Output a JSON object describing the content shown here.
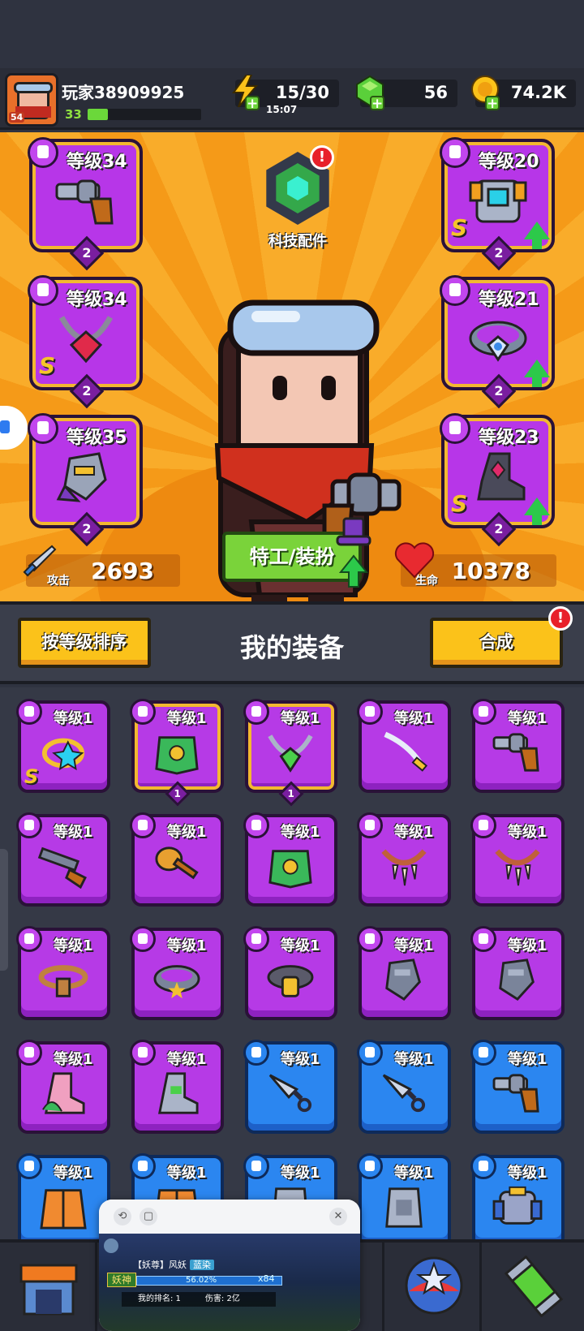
{
  "player": {
    "name": "玩家38909925",
    "level": "33",
    "avatar_level": "54",
    "xp_fraction": 0.18
  },
  "resources": {
    "energy": {
      "value": "15/30",
      "timer": "15:07",
      "icon": "lightning-icon"
    },
    "gems": {
      "value": "56",
      "icon": "green-gem-icon"
    },
    "coins": {
      "value": "74.2K",
      "icon": "gold-coin-icon"
    }
  },
  "equipped": {
    "weapon": {
      "label": "等级34",
      "count": "2",
      "icon": "revolver-icon"
    },
    "necklace": {
      "label": "等级34",
      "count": "2",
      "rank": "S",
      "icon": "necklace-icon"
    },
    "gloves": {
      "label": "等级35",
      "count": "2",
      "icon": "gauntlet-icon"
    },
    "armor": {
      "label": "等级20",
      "count": "2",
      "rank": "S",
      "icon": "armor-icon"
    },
    "belt": {
      "label": "等级21",
      "count": "2",
      "icon": "belt-icon"
    },
    "boots": {
      "label": "等级23",
      "count": "2",
      "rank": "S",
      "icon": "boot-icon"
    }
  },
  "tech": {
    "label": "科技配件",
    "alert": "!"
  },
  "agent_button": "特工/装扮",
  "stats": {
    "attack_label": "攻击",
    "attack": "2693",
    "hp_label": "生命",
    "hp": "10378"
  },
  "equipment_panel": {
    "sort_button": "按等级排序",
    "title": "我的装备",
    "merge_button": "合成",
    "merge_alert": "!"
  },
  "items": [
    {
      "label": "等级1",
      "color": "purple",
      "rank": "S",
      "count": "",
      "icon": "ring-icon"
    },
    {
      "label": "等级1",
      "color": "purple",
      "gold": true,
      "count": "1",
      "icon": "leaf-armor-icon"
    },
    {
      "label": "等级1",
      "color": "purple",
      "gold": true,
      "count": "1",
      "icon": "emerald-necklace-icon"
    },
    {
      "label": "等级1",
      "color": "purple",
      "icon": "saber-icon"
    },
    {
      "label": "等级1",
      "color": "purple",
      "icon": "revolver-icon"
    },
    {
      "label": "等级1",
      "color": "purple",
      "icon": "shotgun-icon"
    },
    {
      "label": "等级1",
      "color": "purple",
      "icon": "torch-icon"
    },
    {
      "label": "等级1",
      "color": "purple",
      "icon": "leaf-armor-icon"
    },
    {
      "label": "等级1",
      "color": "purple",
      "icon": "fang-necklace-icon"
    },
    {
      "label": "等级1",
      "color": "purple",
      "icon": "fang-necklace-icon"
    },
    {
      "label": "等级1",
      "color": "purple",
      "icon": "rope-belt-icon"
    },
    {
      "label": "等级1",
      "color": "purple",
      "icon": "star-belt-icon"
    },
    {
      "label": "等级1",
      "color": "purple",
      "icon": "gold-belt-icon"
    },
    {
      "label": "等级1",
      "color": "purple",
      "icon": "gauntlet-icon"
    },
    {
      "label": "等级1",
      "color": "purple",
      "icon": "gauntlet-icon"
    },
    {
      "label": "等级1",
      "color": "purple",
      "icon": "plant-boot-icon"
    },
    {
      "label": "等级1",
      "color": "purple",
      "icon": "boot-icon"
    },
    {
      "label": "等级1",
      "color": "blue",
      "icon": "kunai-icon"
    },
    {
      "label": "等级1",
      "color": "blue",
      "icon": "kunai-icon"
    },
    {
      "label": "等级1",
      "color": "blue",
      "icon": "revolver-icon"
    },
    {
      "label": "等级1",
      "color": "blue",
      "icon": "jacket-icon"
    },
    {
      "label": "等级1",
      "color": "blue",
      "icon": "jacket-icon"
    },
    {
      "label": "等级1",
      "color": "blue",
      "icon": "vest-icon"
    },
    {
      "label": "等级1",
      "color": "blue",
      "icon": "vest-icon"
    },
    {
      "label": "等级1",
      "color": "blue",
      "icon": "robot-armor-icon"
    }
  ],
  "floating_window": {
    "title_line": "【妖尊】风妖",
    "tag": "蓝染",
    "badge": "妖神",
    "hp_text": "56.02%",
    "multiplier": "x84",
    "rank_text": "我的排名: 1",
    "damage_text": "伤害: 2亿"
  },
  "bottom_nav": [
    {
      "name": "shop",
      "icon": "shop-icon"
    },
    {
      "name": "equipment",
      "icon": "equipment-icon"
    },
    {
      "name": "battle",
      "icon": "battle-icon"
    },
    {
      "name": "stars",
      "icon": "star-ball-icon"
    },
    {
      "name": "dna",
      "icon": "dna-capsule-icon"
    }
  ]
}
